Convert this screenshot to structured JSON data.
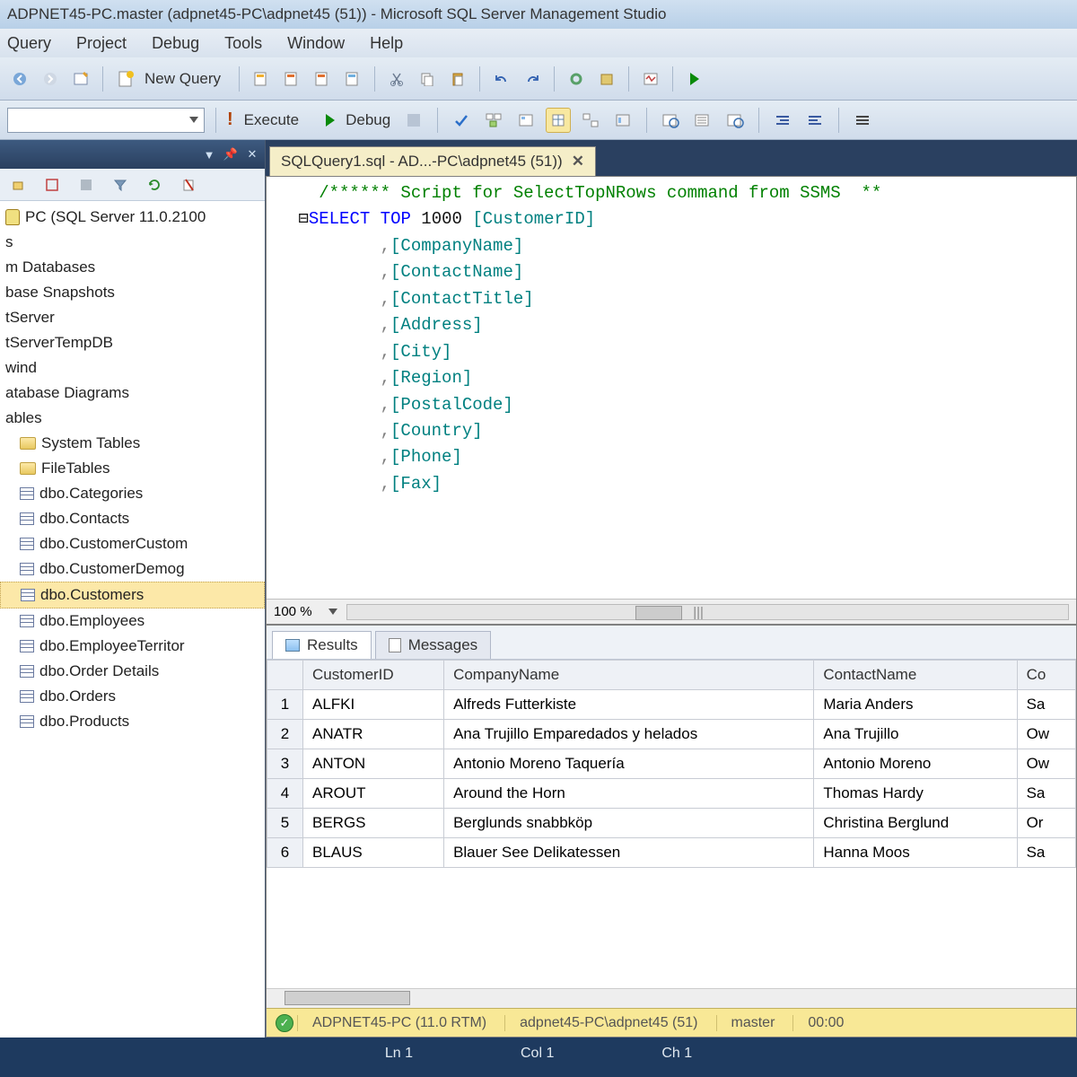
{
  "title": "ADPNET45-PC.master (adpnet45-PC\\adpnet45 (51)) - Microsoft SQL Server Management Studio",
  "menu": [
    "Query",
    "Project",
    "Debug",
    "Tools",
    "Window",
    "Help"
  ],
  "toolbar": {
    "newquery": "New Query"
  },
  "toolbar2": {
    "execute": "Execute",
    "debug": "Debug"
  },
  "explorer": {
    "server": "PC (SQL Server 11.0.2100",
    "items": [
      "s",
      "m Databases",
      "base Snapshots",
      "tServer",
      "tServerTempDB",
      "wind",
      "atabase Diagrams",
      "ables"
    ],
    "subitems": [
      "System Tables",
      "FileTables"
    ],
    "tables": [
      "dbo.Categories",
      "dbo.Contacts",
      "dbo.CustomerCustom",
      "dbo.CustomerDemog",
      "dbo.Customers",
      "dbo.Employees",
      "dbo.EmployeeTerritor",
      "dbo.Order Details",
      "dbo.Orders",
      "dbo.Products"
    ],
    "selected": "dbo.Customers"
  },
  "tab": {
    "label": "SQLQuery1.sql - AD...-PC\\adpnet45 (51))"
  },
  "sql": {
    "comment": "/****** Script for SelectTopNRows command from SSMS  **",
    "select": "SELECT",
    "top": "TOP",
    "topn": "1000",
    "cols": [
      "CustomerID",
      "CompanyName",
      "ContactName",
      "ContactTitle",
      "Address",
      "City",
      "Region",
      "PostalCode",
      "Country",
      "Phone",
      "Fax"
    ]
  },
  "zoom": "100 %",
  "results": {
    "tabs": {
      "results": "Results",
      "messages": "Messages"
    },
    "columns": [
      "CustomerID",
      "CompanyName",
      "ContactName",
      "Co"
    ],
    "rows": [
      {
        "n": "1",
        "id": "ALFKI",
        "co": "Alfreds Futterkiste",
        "cn": "Maria Anders",
        "ct": "Sa"
      },
      {
        "n": "2",
        "id": "ANATR",
        "co": "Ana Trujillo Emparedados y helados",
        "cn": "Ana Trujillo",
        "ct": "Ow"
      },
      {
        "n": "3",
        "id": "ANTON",
        "co": "Antonio Moreno Taquería",
        "cn": "Antonio Moreno",
        "ct": "Ow"
      },
      {
        "n": "4",
        "id": "AROUT",
        "co": "Around the Horn",
        "cn": "Thomas Hardy",
        "ct": "Sa"
      },
      {
        "n": "5",
        "id": "BERGS",
        "co": "Berglunds snabbköp",
        "cn": "Christina Berglund",
        "ct": "Or"
      },
      {
        "n": "6",
        "id": "BLAUS",
        "co": "Blauer See Delikatessen",
        "cn": "Hanna Moos",
        "ct": "Sa"
      }
    ]
  },
  "qstatus": {
    "server": "ADPNET45-PC (11.0 RTM)",
    "login": "adpnet45-PC\\adpnet45 (51)",
    "db": "master",
    "time": "00:00"
  },
  "appstatus": {
    "ln": "Ln 1",
    "col": "Col 1",
    "ch": "Ch 1"
  }
}
